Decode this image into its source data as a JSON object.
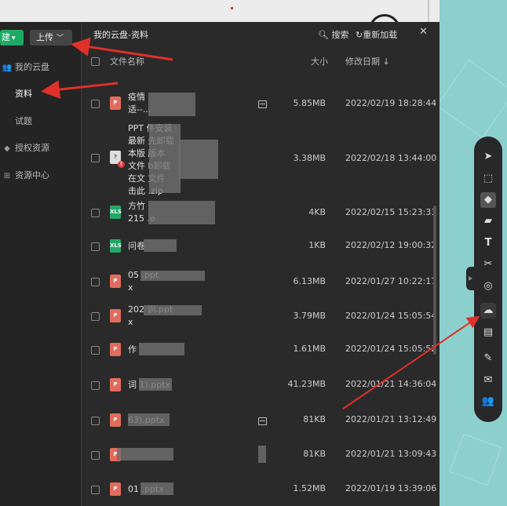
{
  "window": {
    "title": "我的云盘-资料",
    "search_label": "搜索",
    "reload_label": "重新加载",
    "close_glyph": "✕"
  },
  "sidebar": {
    "new_label": "建",
    "upload_label": "上传",
    "items": [
      {
        "label": "我的云盘",
        "icon": "user-group-icon"
      },
      {
        "label": "资料",
        "icon": ""
      },
      {
        "label": "试题",
        "icon": ""
      },
      {
        "label": "授权资源",
        "icon": "shield-icon"
      },
      {
        "label": "资源中心",
        "icon": "share-icon"
      }
    ]
  },
  "columns": {
    "name": "文件名称",
    "size": "大小",
    "modified": "修改日期 ↓"
  },
  "files": [
    {
      "type": "ppt",
      "name": "疫情\n适--...",
      "size": "5.85MB",
      "date": "2022/02/19 18:28:44"
    },
    {
      "type": "zip",
      "name": "PPT            件安装\n最新            先卸载\n本版            版本\n文件            b卸载\n在文            文件\n击此            .zip",
      "size": "3.38MB",
      "date": "2022/02/18 13:44:00"
    },
    {
      "type": "xls",
      "name": "方竹\n215                  .e",
      "size": "4KB",
      "date": "2022/02/15 15:23:33"
    },
    {
      "type": "xls",
      "name": "问卷",
      "size": "1KB",
      "date": "2022/02/12 19:00:32"
    },
    {
      "type": "ppt",
      "name": "05                        .ppt\nx",
      "size": "6.13MB",
      "date": "2022/01/27 10:22:17"
    },
    {
      "type": "ppt",
      "name": "202                    训.ppt\nx",
      "size": "3.79MB",
      "date": "2022/01/24 15:05:54"
    },
    {
      "type": "ppt",
      "name": "作",
      "size": "1.61MB",
      "date": "2022/01/24 15:05:52"
    },
    {
      "type": "ppt",
      "name": "词               1).pptx",
      "size": "41.23MB",
      "date": "2022/01/21 14:36:04"
    },
    {
      "type": "ppt",
      "name": "                63).pptx",
      "size": "81KB",
      "date": "2022/01/21 13:12:49"
    },
    {
      "type": "ppt",
      "name": "",
      "size": "81KB",
      "date": "2022/01/21 13:09:43"
    },
    {
      "type": "ppt",
      "name": "01               .pptx",
      "size": "1.52MB",
      "date": "2022/01/19 13:39:06"
    }
  ],
  "toolbar": {
    "tools": [
      "select-arrow-icon",
      "area-select-icon",
      "paint-fill-icon",
      "eraser-icon",
      "text-icon",
      "scissors-icon",
      "record-icon",
      "cloud-icon",
      "toolbox-icon",
      "edit-icon",
      "chat-icon",
      "users-icon"
    ]
  },
  "colors": {
    "accent_green": "#1eaa64",
    "ppt_red": "#e26c5c",
    "xls_green": "#22a866",
    "arrow_red": "#e0302a",
    "window_bg": "#2a2a2a"
  }
}
